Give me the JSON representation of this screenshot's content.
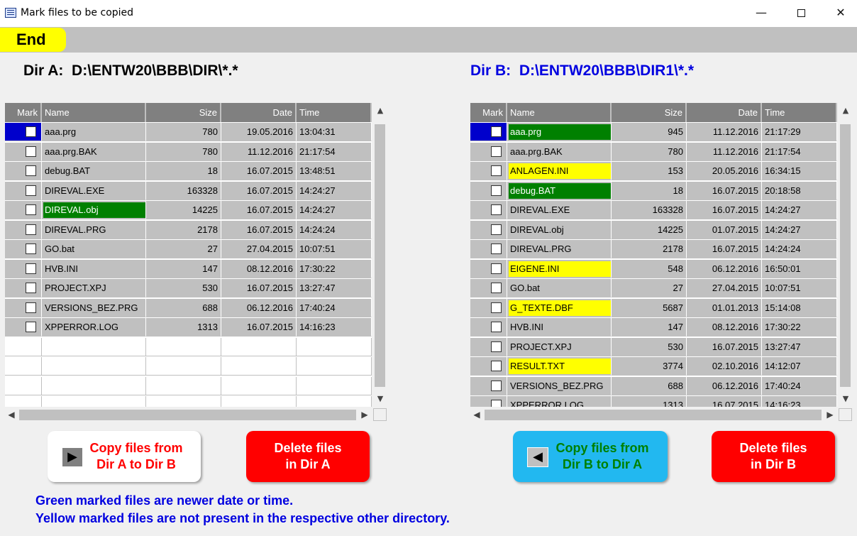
{
  "window": {
    "title": "Mark files to be copied",
    "minimize": "—",
    "close": "✕"
  },
  "menu": {
    "end_label": "End"
  },
  "dir_a": {
    "label": "Dir A:  D:\\ENTW20\\BBB\\DIR\\*.*",
    "columns": [
      "Mark",
      "Name",
      "Size",
      "Date",
      "Time"
    ],
    "rows": [
      {
        "name": "aaa.prg",
        "size": "780",
        "date": "19.05.2016",
        "time": "13:04:31",
        "highlight": ""
      },
      {
        "name": "aaa.prg.BAK",
        "size": "780",
        "date": "11.12.2016",
        "time": "21:17:54",
        "highlight": ""
      },
      {
        "name": "debug.BAT",
        "size": "18",
        "date": "16.07.2015",
        "time": "13:48:51",
        "highlight": ""
      },
      {
        "name": "DIREVAL.EXE",
        "size": "163328",
        "date": "16.07.2015",
        "time": "14:24:27",
        "highlight": ""
      },
      {
        "name": "DIREVAL.obj",
        "size": "14225",
        "date": "16.07.2015",
        "time": "14:24:27",
        "highlight": "green"
      },
      {
        "name": "DIREVAL.PRG",
        "size": "2178",
        "date": "16.07.2015",
        "time": "14:24:24",
        "highlight": ""
      },
      {
        "name": "GO.bat",
        "size": "27",
        "date": "27.04.2015",
        "time": "10:07:51",
        "highlight": ""
      },
      {
        "name": "HVB.INI",
        "size": "147",
        "date": "08.12.2016",
        "time": "17:30:22",
        "highlight": ""
      },
      {
        "name": "PROJECT.XPJ",
        "size": "530",
        "date": "16.07.2015",
        "time": "13:27:47",
        "highlight": ""
      },
      {
        "name": "VERSIONS_BEZ.PRG",
        "size": "688",
        "date": "06.12.2016",
        "time": "17:40:24",
        "highlight": ""
      },
      {
        "name": "XPPERROR.LOG",
        "size": "1313",
        "date": "16.07.2015",
        "time": "14:16:23",
        "highlight": ""
      }
    ]
  },
  "dir_b": {
    "label": "Dir B:  D:\\ENTW20\\BBB\\DIR1\\*.*",
    "columns": [
      "Mark",
      "Name",
      "Size",
      "Date",
      "Time"
    ],
    "rows": [
      {
        "name": "aaa.prg",
        "size": "945",
        "date": "11.12.2016",
        "time": "21:17:29",
        "highlight": "green"
      },
      {
        "name": "aaa.prg.BAK",
        "size": "780",
        "date": "11.12.2016",
        "time": "21:17:54",
        "highlight": ""
      },
      {
        "name": "ANLAGEN.INI",
        "size": "153",
        "date": "20.05.2016",
        "time": "16:34:15",
        "highlight": "yellow"
      },
      {
        "name": "debug.BAT",
        "size": "18",
        "date": "16.07.2015",
        "time": "20:18:58",
        "highlight": "green"
      },
      {
        "name": "DIREVAL.EXE",
        "size": "163328",
        "date": "16.07.2015",
        "time": "14:24:27",
        "highlight": ""
      },
      {
        "name": "DIREVAL.obj",
        "size": "14225",
        "date": "01.07.2015",
        "time": "14:24:27",
        "highlight": ""
      },
      {
        "name": "DIREVAL.PRG",
        "size": "2178",
        "date": "16.07.2015",
        "time": "14:24:24",
        "highlight": ""
      },
      {
        "name": "EIGENE.INI",
        "size": "548",
        "date": "06.12.2016",
        "time": "16:50:01",
        "highlight": "yellow"
      },
      {
        "name": "GO.bat",
        "size": "27",
        "date": "27.04.2015",
        "time": "10:07:51",
        "highlight": ""
      },
      {
        "name": "G_TEXTE.DBF",
        "size": "5687",
        "date": "01.01.2013",
        "time": "15:14:08",
        "highlight": "yellow"
      },
      {
        "name": "HVB.INI",
        "size": "147",
        "date": "08.12.2016",
        "time": "17:30:22",
        "highlight": ""
      },
      {
        "name": "PROJECT.XPJ",
        "size": "530",
        "date": "16.07.2015",
        "time": "13:27:47",
        "highlight": ""
      },
      {
        "name": "RESULT.TXT",
        "size": "3774",
        "date": "02.10.2016",
        "time": "14:12:07",
        "highlight": "yellow"
      },
      {
        "name": "VERSIONS_BEZ.PRG",
        "size": "688",
        "date": "06.12.2016",
        "time": "17:40:24",
        "highlight": ""
      },
      {
        "name": "XPPERROR.LOG",
        "size": "1313",
        "date": "16.07.2015",
        "time": "14:16:23",
        "highlight": ""
      }
    ]
  },
  "buttons": {
    "copy_a_to_b": "Copy files from Dir A to Dir B",
    "delete_a": "Delete files in Dir A",
    "copy_b_to_a": "Copy files from Dir B to Dir A",
    "delete_b": "Delete files in Dir B"
  },
  "legend": {
    "green": "Green marked files are newer date or time.",
    "yellow": "Yellow marked files are not present in the respective other directory."
  },
  "colors": {
    "green_mark": "#008000",
    "yellow_mark": "#ffff00",
    "dir_b_label": "#0000e0",
    "end_button": "#ffff00"
  },
  "icons": {
    "copy_a_to_b": "arrow-right-icon",
    "copy_b_to_a": "arrow-left-icon"
  }
}
